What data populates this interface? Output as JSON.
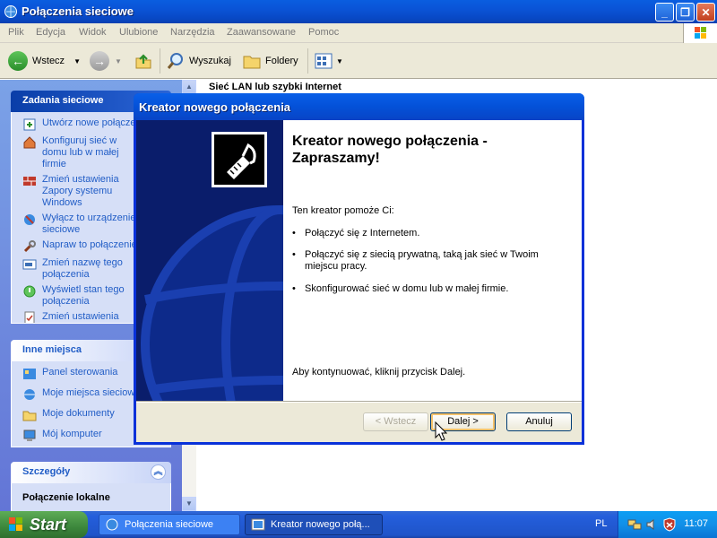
{
  "window": {
    "title": "Połączenia sieciowe",
    "menu": [
      "Plik",
      "Edycja",
      "Widok",
      "Ulubione",
      "Narzędzia",
      "Zaawansowane",
      "Pomoc"
    ]
  },
  "toolbar": {
    "back_label": "Wstecz",
    "search_label": "Wyszukaj",
    "folders_label": "Foldery"
  },
  "taskpane": {
    "network_tasks": {
      "title": "Zadania sieciowe",
      "items": [
        {
          "label": "Utwórz nowe połączenie",
          "icon": "new-connection-icon"
        },
        {
          "label": "Konfiguruj sieć w domu lub w małej firmie",
          "icon": "home-network-icon"
        },
        {
          "label": "Zmień ustawienia Zapory systemu Windows",
          "icon": "firewall-icon"
        },
        {
          "label": "Wyłącz to urządzenie sieciowe",
          "icon": "disable-device-icon"
        },
        {
          "label": "Napraw to połączenie",
          "icon": "repair-icon"
        },
        {
          "label": "Zmień nazwę tego połączenia",
          "icon": "rename-icon"
        },
        {
          "label": "Wyświetl stan tego połączenia",
          "icon": "status-icon"
        },
        {
          "label": "Zmień ustawienia tego połączenia",
          "icon": "properties-icon"
        }
      ]
    },
    "other_places": {
      "title": "Inne miejsca",
      "items": [
        {
          "label": "Panel sterowania",
          "icon": "control-panel-icon"
        },
        {
          "label": "Moje miejsca sieciowe",
          "icon": "network-places-icon"
        },
        {
          "label": "Moje dokumenty",
          "icon": "documents-icon"
        },
        {
          "label": "Mój komputer",
          "icon": "computer-icon"
        }
      ]
    },
    "details": {
      "title": "Szczegóły",
      "item": "Połączenie lokalne"
    }
  },
  "content": {
    "group_header": "Sieć LAN lub szybki Internet"
  },
  "dialog": {
    "title": "Kreator nowego połączenia",
    "heading": "Kreator nowego połączenia - Zapraszamy!",
    "intro": "Ten kreator pomoże Ci:",
    "bullets": [
      "Połączyć się z Internetem.",
      "Połączyć się z siecią prywatną, taką jak sieć w Twoim miejscu pracy.",
      "Skonfigurować sieć w domu lub w małej firmie."
    ],
    "continue_text": "Aby kontynuować, kliknij przycisk Dalej.",
    "back_button": "< Wstecz",
    "next_button": "Dalej >",
    "cancel_button": "Anuluj"
  },
  "taskbar": {
    "start_label": "Start",
    "items": [
      {
        "label": "Połączenia sieciowe"
      },
      {
        "label": "Kreator nowego połą..."
      }
    ],
    "language": "PL",
    "clock": "11:07"
  },
  "colors": {
    "title_blue": "#0a53d6",
    "task_link": "#215dc6",
    "taskbar_blue": "#245edb",
    "start_green": "#3c873c"
  }
}
